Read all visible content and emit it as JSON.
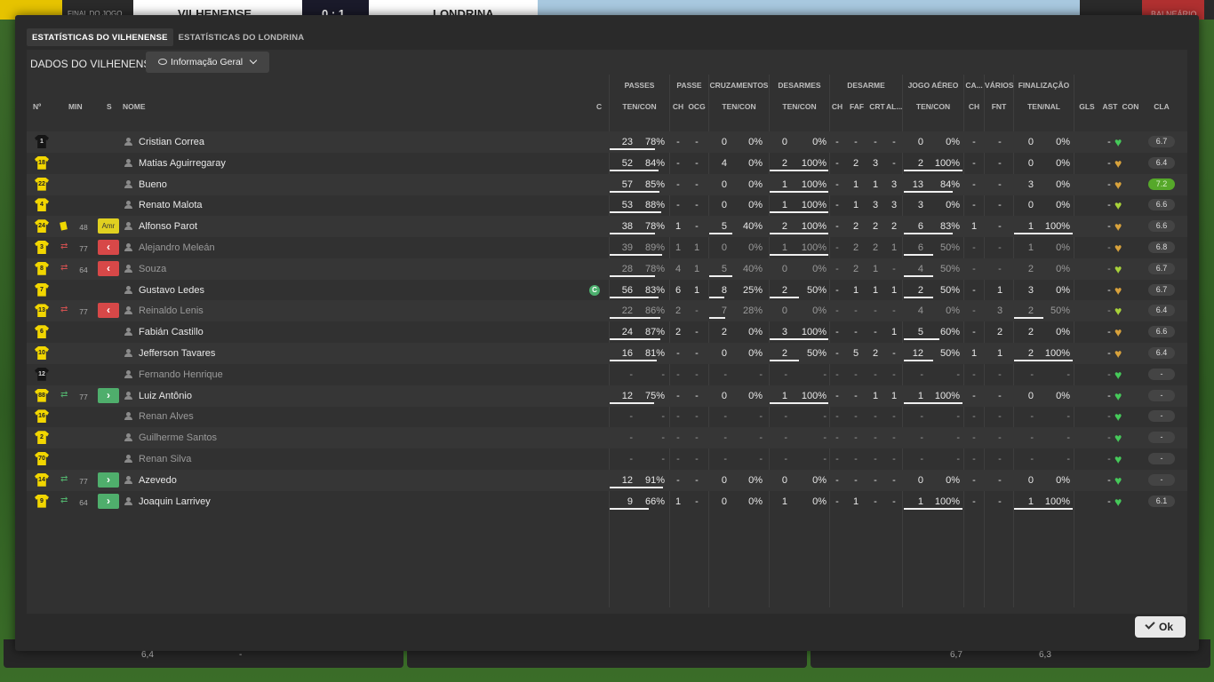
{
  "scoreboard": {
    "period": "FINAL DO JOGO",
    "home_team": "VILHENENSE",
    "score": "0 : 1",
    "away_team": "LONDRINA",
    "right_label": "BALNEÁRIO"
  },
  "tabs": [
    {
      "label": "ESTATÍSTICAS DO VILHENENSE",
      "active": true
    },
    {
      "label": "ESTATÍSTICAS DO LONDRINA",
      "active": false
    }
  ],
  "header": {
    "title": "DADOS DO VILHENENSE",
    "view_selector": "Informação Geral"
  },
  "groups": {
    "passes": "PASSES",
    "passe": "PASSE",
    "cruzamentos": "CRUZAMENTOS",
    "desarmes": "DESARMES",
    "desarme": "DESARME",
    "jogo_aereo": "JOGO AÉREO",
    "ca": "CA...",
    "varios": "VÁRIOS",
    "finalizacao": "FINALIZAÇÃO"
  },
  "columns": {
    "num": "Nº",
    "min": "MIN",
    "s": "S",
    "nome": "NOME",
    "c": "C",
    "ten_con": "TEN/CON",
    "ch": "CH",
    "ocg": "OCG",
    "faf": "FAF",
    "crt": "CRT",
    "al": "AL...",
    "fnt": "FNT",
    "ten_nal": "TEN/NAL",
    "gls": "GLS",
    "ast": "AST",
    "con": "CON",
    "cla": "CLA"
  },
  "colors": {
    "shirt": "#f2d600",
    "gk_shirt": "#151515",
    "sub_out": "#d74848",
    "sub_in": "#4fae6c",
    "heart_green": "#46c95a",
    "heart_gold": "#d8a23c",
    "rating_good": "#56a82a"
  },
  "players": [
    {
      "num": "1",
      "gk": true,
      "card": "",
      "min": "",
      "sub": "",
      "name": "Cristian Correa",
      "captain": false,
      "dim": false,
      "p_ten": "23",
      "p_con": "78%",
      "p_ch": "-",
      "p_ocg": "-",
      "cr_ten": "0",
      "cr_con": "0%",
      "ds_ten": "0",
      "ds_con": "0%",
      "d_ch": "-",
      "d_faf": "-",
      "d_crt": "-",
      "d_al": "-",
      "ja_ten": "0",
      "ja_con": "0%",
      "ca_ch": "-",
      "fnt": "-",
      "f_ten": "0",
      "f_nal": "0%",
      "gls": "",
      "ast": "-",
      "heart": "green",
      "cla": "6.7",
      "good": false,
      "bar_p": 0.78,
      "bar_cr": 0,
      "bar_ds": 0,
      "bar_ja": 0,
      "bar_f": 0
    },
    {
      "num": "18",
      "gk": false,
      "card": "",
      "min": "",
      "sub": "",
      "name": "Matias Aguirregaray",
      "captain": false,
      "dim": false,
      "p_ten": "52",
      "p_con": "84%",
      "p_ch": "-",
      "p_ocg": "-",
      "cr_ten": "4",
      "cr_con": "0%",
      "ds_ten": "2",
      "ds_con": "100%",
      "d_ch": "-",
      "d_faf": "2",
      "d_crt": "3",
      "d_al": "-",
      "ja_ten": "2",
      "ja_con": "100%",
      "ca_ch": "-",
      "fnt": "-",
      "f_ten": "0",
      "f_nal": "0%",
      "gls": "",
      "ast": "-",
      "heart": "gold",
      "cla": "6.4",
      "good": false,
      "bar_p": 0.84,
      "bar_cr": 0,
      "bar_ds": 1,
      "bar_ja": 1,
      "bar_f": 0
    },
    {
      "num": "22",
      "gk": false,
      "card": "",
      "min": "",
      "sub": "",
      "name": "Bueno",
      "captain": false,
      "dim": false,
      "p_ten": "57",
      "p_con": "85%",
      "p_ch": "-",
      "p_ocg": "-",
      "cr_ten": "0",
      "cr_con": "0%",
      "ds_ten": "1",
      "ds_con": "100%",
      "d_ch": "-",
      "d_faf": "1",
      "d_crt": "1",
      "d_al": "3",
      "ja_ten": "13",
      "ja_con": "84%",
      "ca_ch": "-",
      "fnt": "-",
      "f_ten": "3",
      "f_nal": "0%",
      "gls": "",
      "ast": "-",
      "heart": "gold",
      "cla": "7.2",
      "good": true,
      "bar_p": 0.85,
      "bar_cr": 0,
      "bar_ds": 1,
      "bar_ja": 0.84,
      "bar_f": 0
    },
    {
      "num": "4",
      "gk": false,
      "card": "",
      "min": "",
      "sub": "",
      "name": "Renato Malota",
      "captain": false,
      "dim": false,
      "p_ten": "53",
      "p_con": "88%",
      "p_ch": "-",
      "p_ocg": "-",
      "cr_ten": "0",
      "cr_con": "0%",
      "ds_ten": "1",
      "ds_con": "100%",
      "d_ch": "-",
      "d_faf": "1",
      "d_crt": "3",
      "d_al": "3",
      "ja_ten": "3",
      "ja_con": "0%",
      "ca_ch": "-",
      "fnt": "-",
      "f_ten": "0",
      "f_nal": "0%",
      "gls": "",
      "ast": "-",
      "heart": "lime",
      "cla": "6.6",
      "good": false,
      "bar_p": 0.88,
      "bar_cr": 0,
      "bar_ds": 1,
      "bar_ja": 0,
      "bar_f": 0
    },
    {
      "num": "24",
      "gk": false,
      "card": "yellow",
      "min": "48",
      "sub": "amr",
      "name": "Alfonso Parot",
      "captain": false,
      "dim": false,
      "p_ten": "38",
      "p_con": "78%",
      "p_ch": "1",
      "p_ocg": "-",
      "cr_ten": "5",
      "cr_con": "40%",
      "ds_ten": "2",
      "ds_con": "100%",
      "d_ch": "-",
      "d_faf": "2",
      "d_crt": "2",
      "d_al": "2",
      "ja_ten": "6",
      "ja_con": "83%",
      "ca_ch": "1",
      "fnt": "-",
      "f_ten": "1",
      "f_nal": "100%",
      "gls": "",
      "ast": "-",
      "heart": "gold",
      "cla": "6.6",
      "good": false,
      "bar_p": 0.78,
      "bar_cr": 0.4,
      "bar_ds": 1,
      "bar_ja": 0.83,
      "bar_f": 1
    },
    {
      "num": "3",
      "gk": false,
      "card": "",
      "min": "77",
      "sub": "out",
      "name": "Alejandro Meleán",
      "captain": false,
      "dim": true,
      "p_ten": "39",
      "p_con": "89%",
      "p_ch": "1",
      "p_ocg": "1",
      "cr_ten": "0",
      "cr_con": "0%",
      "ds_ten": "1",
      "ds_con": "100%",
      "d_ch": "-",
      "d_faf": "2",
      "d_crt": "2",
      "d_al": "1",
      "ja_ten": "6",
      "ja_con": "50%",
      "ca_ch": "-",
      "fnt": "-",
      "f_ten": "1",
      "f_nal": "0%",
      "gls": "",
      "ast": "-",
      "heart": "gold",
      "cla": "6.8",
      "good": false,
      "bar_p": 0.89,
      "bar_cr": 0,
      "bar_ds": 1,
      "bar_ja": 0.5,
      "bar_f": 0
    },
    {
      "num": "8",
      "gk": false,
      "card": "",
      "min": "64",
      "sub": "out",
      "name": "Souza",
      "captain": false,
      "dim": true,
      "p_ten": "28",
      "p_con": "78%",
      "p_ch": "4",
      "p_ocg": "1",
      "cr_ten": "5",
      "cr_con": "40%",
      "ds_ten": "0",
      "ds_con": "0%",
      "d_ch": "-",
      "d_faf": "2",
      "d_crt": "1",
      "d_al": "-",
      "ja_ten": "4",
      "ja_con": "50%",
      "ca_ch": "-",
      "fnt": "-",
      "f_ten": "2",
      "f_nal": "0%",
      "gls": "",
      "ast": "-",
      "heart": "lime",
      "cla": "6.7",
      "good": false,
      "bar_p": 0.78,
      "bar_cr": 0.4,
      "bar_ds": 0,
      "bar_ja": 0.5,
      "bar_f": 0
    },
    {
      "num": "7",
      "gk": false,
      "card": "",
      "min": "",
      "sub": "",
      "name": "Gustavo Ledes",
      "captain": true,
      "dim": false,
      "p_ten": "56",
      "p_con": "83%",
      "p_ch": "6",
      "p_ocg": "1",
      "cr_ten": "8",
      "cr_con": "25%",
      "ds_ten": "2",
      "ds_con": "50%",
      "d_ch": "-",
      "d_faf": "1",
      "d_crt": "1",
      "d_al": "1",
      "ja_ten": "2",
      "ja_con": "50%",
      "ca_ch": "-",
      "fnt": "1",
      "f_ten": "3",
      "f_nal": "0%",
      "gls": "",
      "ast": "-",
      "heart": "gold",
      "cla": "6.7",
      "good": false,
      "bar_p": 0.83,
      "bar_cr": 0.25,
      "bar_ds": 0.5,
      "bar_ja": 0.5,
      "bar_f": 0
    },
    {
      "num": "13",
      "gk": false,
      "card": "",
      "min": "77",
      "sub": "out",
      "name": "Reinaldo Lenis",
      "captain": false,
      "dim": true,
      "p_ten": "22",
      "p_con": "86%",
      "p_ch": "2",
      "p_ocg": "-",
      "cr_ten": "7",
      "cr_con": "28%",
      "ds_ten": "0",
      "ds_con": "0%",
      "d_ch": "-",
      "d_faf": "-",
      "d_crt": "-",
      "d_al": "-",
      "ja_ten": "4",
      "ja_con": "0%",
      "ca_ch": "-",
      "fnt": "3",
      "f_ten": "2",
      "f_nal": "50%",
      "gls": "",
      "ast": "-",
      "heart": "lime",
      "cla": "6.4",
      "good": false,
      "bar_p": 0.86,
      "bar_cr": 0.28,
      "bar_ds": 0,
      "bar_ja": 0,
      "bar_f": 0.5
    },
    {
      "num": "6",
      "gk": false,
      "card": "",
      "min": "",
      "sub": "",
      "name": "Fabián Castillo",
      "captain": false,
      "dim": false,
      "p_ten": "24",
      "p_con": "87%",
      "p_ch": "2",
      "p_ocg": "-",
      "cr_ten": "2",
      "cr_con": "0%",
      "ds_ten": "3",
      "ds_con": "100%",
      "d_ch": "-",
      "d_faf": "-",
      "d_crt": "-",
      "d_al": "1",
      "ja_ten": "5",
      "ja_con": "60%",
      "ca_ch": "-",
      "fnt": "2",
      "f_ten": "2",
      "f_nal": "0%",
      "gls": "",
      "ast": "-",
      "heart": "gold",
      "cla": "6.6",
      "good": false,
      "bar_p": 0.87,
      "bar_cr": 0,
      "bar_ds": 1,
      "bar_ja": 0.6,
      "bar_f": 0
    },
    {
      "num": "10",
      "gk": false,
      "card": "",
      "min": "",
      "sub": "",
      "name": "Jefferson Tavares",
      "captain": false,
      "dim": false,
      "p_ten": "16",
      "p_con": "81%",
      "p_ch": "-",
      "p_ocg": "-",
      "cr_ten": "0",
      "cr_con": "0%",
      "ds_ten": "2",
      "ds_con": "50%",
      "d_ch": "-",
      "d_faf": "5",
      "d_crt": "2",
      "d_al": "-",
      "ja_ten": "12",
      "ja_con": "50%",
      "ca_ch": "1",
      "fnt": "1",
      "f_ten": "2",
      "f_nal": "100%",
      "gls": "",
      "ast": "-",
      "heart": "gold",
      "cla": "6.4",
      "good": false,
      "bar_p": 0.81,
      "bar_cr": 0,
      "bar_ds": 0.5,
      "bar_ja": 0.5,
      "bar_f": 1
    },
    {
      "num": "12",
      "gk": true,
      "card": "",
      "min": "",
      "sub": "",
      "name": "Fernando Henrique",
      "captain": false,
      "dim": true,
      "p_ten": "-",
      "p_con": "-",
      "p_ch": "-",
      "p_ocg": "-",
      "cr_ten": "-",
      "cr_con": "-",
      "ds_ten": "-",
      "ds_con": "-",
      "d_ch": "-",
      "d_faf": "-",
      "d_crt": "-",
      "d_al": "-",
      "ja_ten": "-",
      "ja_con": "-",
      "ca_ch": "-",
      "fnt": "-",
      "f_ten": "-",
      "f_nal": "-",
      "gls": "",
      "ast": "-",
      "heart": "green",
      "cla": "-",
      "good": false,
      "bar_p": 0,
      "bar_cr": 0,
      "bar_ds": 0,
      "bar_ja": 0,
      "bar_f": 0
    },
    {
      "num": "88",
      "gk": false,
      "card": "",
      "min": "77",
      "sub": "in",
      "name": "Luiz Antônio",
      "captain": false,
      "dim": false,
      "p_ten": "12",
      "p_con": "75%",
      "p_ch": "-",
      "p_ocg": "-",
      "cr_ten": "0",
      "cr_con": "0%",
      "ds_ten": "1",
      "ds_con": "100%",
      "d_ch": "-",
      "d_faf": "-",
      "d_crt": "1",
      "d_al": "1",
      "ja_ten": "1",
      "ja_con": "100%",
      "ca_ch": "-",
      "fnt": "-",
      "f_ten": "0",
      "f_nal": "0%",
      "gls": "",
      "ast": "-",
      "heart": "green",
      "cla": "-",
      "good": false,
      "bar_p": 0.75,
      "bar_cr": 0,
      "bar_ds": 1,
      "bar_ja": 1,
      "bar_f": 0
    },
    {
      "num": "16",
      "gk": false,
      "card": "",
      "min": "",
      "sub": "",
      "name": "Renan Alves",
      "captain": false,
      "dim": true,
      "p_ten": "-",
      "p_con": "-",
      "p_ch": "-",
      "p_ocg": "-",
      "cr_ten": "-",
      "cr_con": "-",
      "ds_ten": "-",
      "ds_con": "-",
      "d_ch": "-",
      "d_faf": "-",
      "d_crt": "-",
      "d_al": "-",
      "ja_ten": "-",
      "ja_con": "-",
      "ca_ch": "-",
      "fnt": "-",
      "f_ten": "-",
      "f_nal": "-",
      "gls": "",
      "ast": "-",
      "heart": "green",
      "cla": "-",
      "good": false,
      "bar_p": 0,
      "bar_cr": 0,
      "bar_ds": 0,
      "bar_ja": 0,
      "bar_f": 0
    },
    {
      "num": "2",
      "gk": false,
      "card": "",
      "min": "",
      "sub": "",
      "name": "Guilherme Santos",
      "captain": false,
      "dim": true,
      "p_ten": "-",
      "p_con": "-",
      "p_ch": "-",
      "p_ocg": "-",
      "cr_ten": "-",
      "cr_con": "-",
      "ds_ten": "-",
      "ds_con": "-",
      "d_ch": "-",
      "d_faf": "-",
      "d_crt": "-",
      "d_al": "-",
      "ja_ten": "-",
      "ja_con": "-",
      "ca_ch": "-",
      "fnt": "-",
      "f_ten": "-",
      "f_nal": "-",
      "gls": "",
      "ast": "-",
      "heart": "green",
      "cla": "-",
      "good": false,
      "bar_p": 0,
      "bar_cr": 0,
      "bar_ds": 0,
      "bar_ja": 0,
      "bar_f": 0
    },
    {
      "num": "70",
      "gk": false,
      "card": "",
      "min": "",
      "sub": "",
      "name": "Renan Silva",
      "captain": false,
      "dim": true,
      "p_ten": "-",
      "p_con": "-",
      "p_ch": "-",
      "p_ocg": "-",
      "cr_ten": "-",
      "cr_con": "-",
      "ds_ten": "-",
      "ds_con": "-",
      "d_ch": "-",
      "d_faf": "-",
      "d_crt": "-",
      "d_al": "-",
      "ja_ten": "-",
      "ja_con": "-",
      "ca_ch": "-",
      "fnt": "-",
      "f_ten": "-",
      "f_nal": "-",
      "gls": "",
      "ast": "-",
      "heart": "green",
      "cla": "-",
      "good": false,
      "bar_p": 0,
      "bar_cr": 0,
      "bar_ds": 0,
      "bar_ja": 0,
      "bar_f": 0
    },
    {
      "num": "14",
      "gk": false,
      "card": "",
      "min": "77",
      "sub": "in",
      "name": "Azevedo",
      "captain": false,
      "dim": false,
      "p_ten": "12",
      "p_con": "91%",
      "p_ch": "-",
      "p_ocg": "-",
      "cr_ten": "0",
      "cr_con": "0%",
      "ds_ten": "0",
      "ds_con": "0%",
      "d_ch": "-",
      "d_faf": "-",
      "d_crt": "-",
      "d_al": "-",
      "ja_ten": "0",
      "ja_con": "0%",
      "ca_ch": "-",
      "fnt": "-",
      "f_ten": "0",
      "f_nal": "0%",
      "gls": "",
      "ast": "-",
      "heart": "green",
      "cla": "-",
      "good": false,
      "bar_p": 0.91,
      "bar_cr": 0,
      "bar_ds": 0,
      "bar_ja": 0,
      "bar_f": 0
    },
    {
      "num": "9",
      "gk": false,
      "card": "",
      "min": "64",
      "sub": "in",
      "name": "Joaquin Larrivey",
      "captain": false,
      "dim": false,
      "p_ten": "9",
      "p_con": "66%",
      "p_ch": "1",
      "p_ocg": "-",
      "cr_ten": "0",
      "cr_con": "0%",
      "ds_ten": "1",
      "ds_con": "0%",
      "d_ch": "-",
      "d_faf": "1",
      "d_crt": "-",
      "d_al": "-",
      "ja_ten": "1",
      "ja_con": "100%",
      "ca_ch": "-",
      "fnt": "-",
      "f_ten": "1",
      "f_nal": "100%",
      "gls": "",
      "ast": "-",
      "heart": "green",
      "cla": "6.1",
      "good": false,
      "bar_p": 0.66,
      "bar_cr": 0,
      "bar_ds": 0,
      "bar_ja": 1,
      "bar_f": 1
    }
  ],
  "sub_glyphs": {
    "out": "‹",
    "in": "›",
    "amr": "Amr"
  },
  "bottom": {
    "left_a": "6,4",
    "left_b": "-",
    "right_a": "6,7",
    "right_b": "6,3"
  },
  "ok_label": "Ok",
  "captain_mark": "C"
}
